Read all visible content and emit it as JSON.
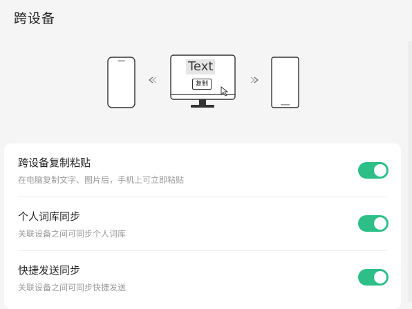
{
  "header": {
    "title": "跨设备"
  },
  "illustration": {
    "monitor_text": "Text",
    "monitor_copy_label": "复制",
    "icons": {
      "left_phone": "phone-icon",
      "right_phone": "phone-icon",
      "monitor": "monitor-icon",
      "left_arrow": "chevron-left-icon",
      "right_arrow": "chevron-right-icon",
      "cursor": "cursor-icon"
    }
  },
  "settings": {
    "rows": [
      {
        "title": "跨设备复制粘贴",
        "desc": "在电脑复制文字、图片后，手机上可立即粘贴",
        "enabled": true
      },
      {
        "title": "个人词库同步",
        "desc": "关联设备之间可同步个人词库",
        "enabled": true
      },
      {
        "title": "快捷发送同步",
        "desc": "关联设备之间可同步快捷发送",
        "enabled": true
      }
    ]
  },
  "colors": {
    "accent": "#2dbf87",
    "background": "#f5f5f5",
    "card": "#ffffff",
    "desc_text": "#9a9a9a"
  }
}
